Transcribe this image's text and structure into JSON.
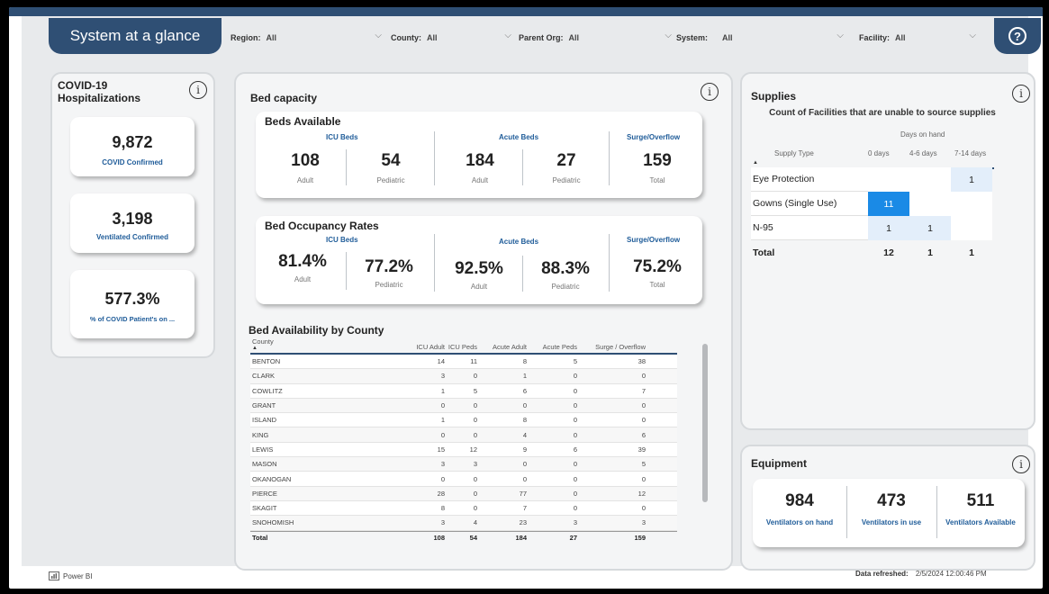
{
  "header": {
    "title": "System at a glance",
    "filters": [
      {
        "label": "Region:",
        "value": "All"
      },
      {
        "label": "County:",
        "value": "All"
      },
      {
        "label": "Parent Org:",
        "value": "All"
      },
      {
        "label": "System:",
        "value": "All"
      },
      {
        "label": "Facility:",
        "value": "All"
      }
    ],
    "help_glyph": "?"
  },
  "covid": {
    "title_line1": "COVID-19",
    "title_line2": "Hospitalizations",
    "kpis": [
      {
        "value": "9,872",
        "label": "COVID Confirmed"
      },
      {
        "value": "3,198",
        "label": "Ventilated Confirmed"
      },
      {
        "value": "577.3%",
        "label": "% of COVID Patient's on ..."
      }
    ]
  },
  "bed_capacity": {
    "title": "Bed capacity",
    "available": {
      "title": "Beds Available",
      "groups": [
        "ICU Beds",
        "Acute Beds",
        "Surge/Overflow"
      ],
      "values": [
        {
          "value": "108",
          "label": "Adult"
        },
        {
          "value": "54",
          "label": "Pediatric"
        },
        {
          "value": "184",
          "label": "Adult"
        },
        {
          "value": "27",
          "label": "Pediatric"
        },
        {
          "value": "159",
          "label": "Total"
        }
      ]
    },
    "occupancy": {
      "title": "Bed Occupancy Rates",
      "groups": [
        "ICU Beds",
        "Acute Beds",
        "Surge/Overflow"
      ],
      "values": [
        {
          "value": "81.4%",
          "label": "Adult"
        },
        {
          "value": "77.2%",
          "label": "Pediatric"
        },
        {
          "value": "92.5%",
          "label": "Adult"
        },
        {
          "value": "88.3%",
          "label": "Pediatric"
        },
        {
          "value": "75.2%",
          "label": "Total"
        }
      ]
    }
  },
  "county_table": {
    "title": "Bed Availability by County",
    "columns": [
      "County",
      "ICU Adult",
      "ICU Peds",
      "Acute Adult",
      "Acute Peds",
      "Surge / Overflow"
    ],
    "rows": [
      [
        "BENTON",
        "14",
        "11",
        "8",
        "5",
        "38"
      ],
      [
        "CLARK",
        "3",
        "0",
        "1",
        "0",
        "0"
      ],
      [
        "COWLITZ",
        "1",
        "5",
        "6",
        "0",
        "7"
      ],
      [
        "GRANT",
        "0",
        "0",
        "0",
        "0",
        "0"
      ],
      [
        "ISLAND",
        "1",
        "0",
        "8",
        "0",
        "0"
      ],
      [
        "KING",
        "0",
        "0",
        "4",
        "0",
        "6"
      ],
      [
        "LEWIS",
        "15",
        "12",
        "9",
        "6",
        "39"
      ],
      [
        "MASON",
        "3",
        "3",
        "0",
        "0",
        "5"
      ],
      [
        "OKANOGAN",
        "0",
        "0",
        "0",
        "0",
        "0"
      ],
      [
        "PIERCE",
        "28",
        "0",
        "77",
        "0",
        "12"
      ],
      [
        "SKAGIT",
        "8",
        "0",
        "7",
        "0",
        "0"
      ],
      [
        "SNOHOMISH",
        "3",
        "4",
        "23",
        "3",
        "3"
      ]
    ],
    "total": [
      "Total",
      "108",
      "54",
      "184",
      "27",
      "159"
    ]
  },
  "supplies": {
    "title": "Supplies",
    "subtitle": "Count of Facilities that are unable to source supplies",
    "col_group": "Days on hand",
    "columns": [
      "Supply Type",
      "0 days",
      "4-6 days",
      "7-14 days"
    ],
    "rows": [
      {
        "name": "Eye Protection",
        "cells": [
          "",
          "",
          "1"
        ],
        "shade": [
          0,
          0,
          1
        ]
      },
      {
        "name": "Gowns (Single Use)",
        "cells": [
          "11",
          "",
          ""
        ],
        "shade": [
          3,
          0,
          0
        ]
      },
      {
        "name": "N-95",
        "cells": [
          "1",
          "1",
          ""
        ],
        "shade": [
          1,
          1,
          0
        ]
      }
    ],
    "total": [
      "Total",
      "12",
      "1",
      "1"
    ],
    "shade_colors": [
      "#ffffff",
      "#e3eefa",
      "#cfe3f7",
      "#1a8ae6"
    ]
  },
  "equipment": {
    "title": "Equipment",
    "kpis": [
      {
        "value": "984",
        "label": "Ventilators on hand"
      },
      {
        "value": "473",
        "label": "Ventilators in use"
      },
      {
        "value": "511",
        "label": "Ventilators Available"
      }
    ]
  },
  "footer": {
    "brand": "Power BI",
    "refreshed_label": "Data refreshed:",
    "refreshed_value": "2/5/2024 12:00:46 PM"
  },
  "info_glyph": "i"
}
